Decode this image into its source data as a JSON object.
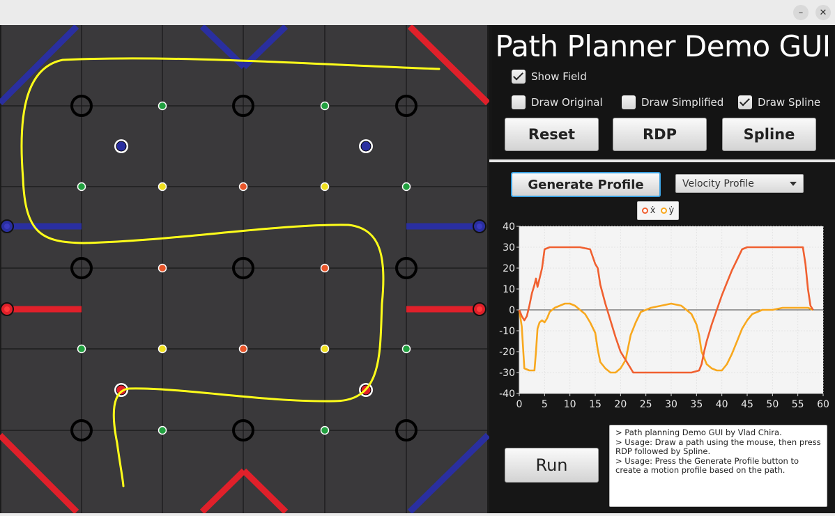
{
  "window": {
    "minimize_glyph": "–",
    "close_glyph": "✕"
  },
  "app": {
    "title": "Path Planner Demo GUI"
  },
  "controls": {
    "show_field": {
      "label": "Show Field",
      "checked": true
    },
    "draw_original": {
      "label": "Draw Original",
      "checked": false
    },
    "draw_simplified": {
      "label": "Draw Simplified",
      "checked": false
    },
    "draw_spline": {
      "label": "Draw Spline",
      "checked": true
    },
    "reset_label": "Reset",
    "rdp_label": "RDP",
    "spline_label": "Spline",
    "generate_label": "Generate Profile",
    "profile_select": "Velocity Profile",
    "run_label": "Run"
  },
  "legend": {
    "x_dot": "ẋ",
    "y_dot": "ẏ"
  },
  "colors": {
    "series_x": "#f06030",
    "series_y": "#f8a81e",
    "path": "#ffff1a",
    "blue": "#2a2fa0",
    "red": "#e0202a"
  },
  "console": {
    "lines": [
      "> Path planning Demo GUI by Vlad Chira.",
      "> Usage: Draw a path using the mouse, then press RDP followed by Spline.",
      "> Usage: Press the Generate Profile button to create a motion profile based on the path."
    ]
  },
  "chart_data": {
    "type": "line",
    "xlim": [
      0,
      60
    ],
    "ylim": [
      -40,
      40
    ],
    "x_ticks": [
      "0",
      "5",
      "10",
      "15",
      "20",
      "25",
      "30",
      "35",
      "40",
      "45",
      "50",
      "55",
      "60"
    ],
    "y_ticks": [
      "40",
      "30",
      "20",
      "10",
      "0",
      "-10",
      "-20",
      "-30",
      "-40"
    ],
    "grid": true,
    "legend_position": "top",
    "series": [
      {
        "name": "ẋ",
        "x": [
          0,
          0.5,
          1,
          1.5,
          2,
          2.5,
          3,
          3.3,
          3.6,
          4,
          4.5,
          5,
          6,
          8,
          10,
          12,
          14,
          15,
          15.5,
          16,
          17,
          18,
          19,
          20,
          21,
          22,
          22.5,
          23,
          25,
          28,
          31,
          34,
          35.5,
          36,
          36.5,
          37,
          38,
          39,
          40,
          41,
          42,
          43,
          44,
          45,
          46,
          48,
          52,
          56,
          56.5,
          57,
          57.5,
          58
        ],
        "y": [
          0,
          -3,
          -5,
          -3,
          2,
          8,
          12,
          15,
          11,
          15,
          20,
          29,
          30,
          30,
          30,
          30,
          29,
          22,
          20,
          12,
          3,
          -5,
          -13,
          -20,
          -24,
          -28,
          -30,
          -30,
          -30,
          -30,
          -30,
          -30,
          -29,
          -26,
          -20,
          -15,
          -7,
          0,
          7,
          13,
          19,
          24,
          29,
          30,
          30,
          30,
          30,
          30,
          22,
          10,
          2,
          0
        ]
      },
      {
        "name": "ẏ",
        "x": [
          0,
          0.5,
          1,
          2,
          3,
          3.3,
          3.6,
          4,
          4.5,
          5,
          5.5,
          6,
          7,
          8,
          9,
          10,
          11,
          12,
          13,
          14,
          15,
          15.5,
          16,
          17,
          18,
          19,
          20,
          21,
          21.5,
          22,
          23,
          24,
          25,
          26,
          28,
          30,
          32,
          33,
          34,
          35,
          35.5,
          36,
          37,
          38,
          39,
          40,
          41,
          42,
          43,
          44,
          45,
          46,
          48,
          50,
          52,
          54,
          56,
          57,
          58
        ],
        "y": [
          0,
          -8,
          -28,
          -29,
          -29,
          -20,
          -9,
          -6,
          -5,
          -6,
          -4,
          -1,
          1,
          2,
          3,
          3,
          2,
          0,
          -2,
          -6,
          -11,
          -19,
          -25,
          -28,
          -30,
          -30,
          -28,
          -24,
          -18,
          -12,
          -6,
          -1,
          0,
          1,
          2,
          3,
          2,
          0,
          -2,
          -7,
          -12,
          -20,
          -26,
          -28,
          -29,
          -29,
          -26,
          -21,
          -15,
          -9,
          -5,
          -2,
          0,
          0,
          1,
          1,
          1,
          1,
          0
        ]
      }
    ]
  }
}
